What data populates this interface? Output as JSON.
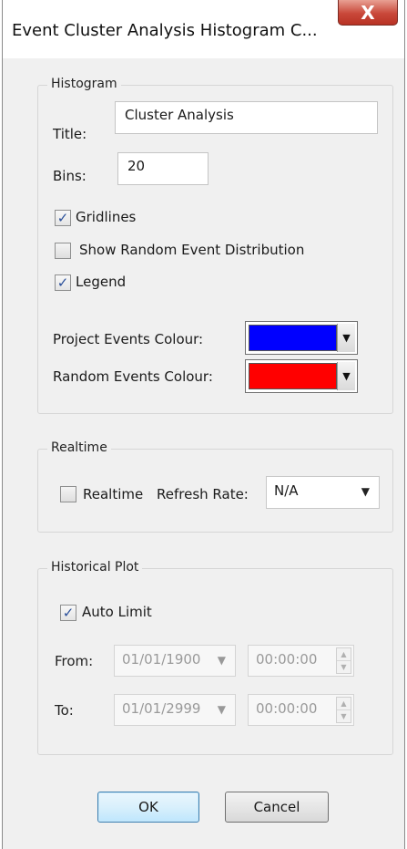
{
  "window": {
    "title": "Event Cluster Analysis Histogram C...",
    "close_glyph": "X"
  },
  "histogram": {
    "group_label": "Histogram",
    "title_label": "Title:",
    "title_value": "Cluster Analysis",
    "bins_label": "Bins:",
    "bins_value": "20",
    "gridlines": {
      "label": "Gridlines",
      "checked": true
    },
    "show_random": {
      "label": "Show Random Event Distribution",
      "checked": false
    },
    "legend": {
      "label": "Legend",
      "checked": true
    },
    "project_colour_label": "Project Events Colour:",
    "project_colour": "#0000ff",
    "random_colour_label": "Random Events Colour:",
    "random_colour": "#ff0000"
  },
  "realtime": {
    "group_label": "Realtime",
    "checkbox_label": "Realtime",
    "checked": false,
    "refresh_label": "Refresh Rate:",
    "refresh_value": "N/A"
  },
  "historical": {
    "group_label": "Historical Plot",
    "auto_limit": {
      "label": "Auto Limit",
      "checked": true
    },
    "from_label": "From:",
    "from_date": "01/01/1900",
    "from_time": "00:00:00",
    "to_label": "To:",
    "to_date": "01/01/2999",
    "to_time": "00:00:00"
  },
  "buttons": {
    "ok": "OK",
    "cancel": "Cancel"
  },
  "glyphs": {
    "check": "✓",
    "dropdown": "▼",
    "spin_up": "▲",
    "spin_down": "▼"
  }
}
